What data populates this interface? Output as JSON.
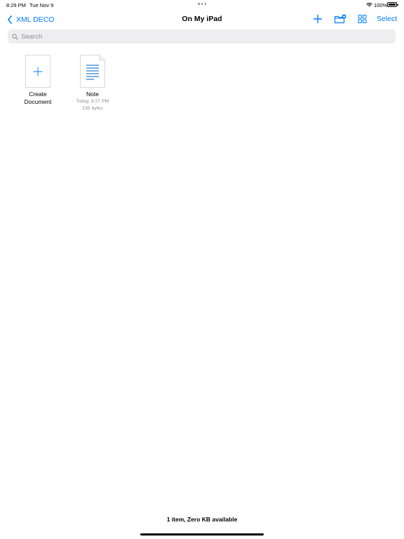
{
  "status_bar": {
    "time": "8:29 PM",
    "date": "Tue Nov 9",
    "battery": "100%",
    "icons": [
      "wifi-icon",
      "battery-icon"
    ]
  },
  "nav": {
    "back_label": "XML DECO",
    "title": "On My iPad",
    "select_label": "Select",
    "icons": [
      "chevron-left-icon",
      "plus-icon",
      "folder-badge-plus-icon",
      "grid-icon"
    ]
  },
  "search": {
    "placeholder": "Search",
    "value": ""
  },
  "items": [
    {
      "name_line1": "Create",
      "name_line2": "Document",
      "icon": "plus-icon"
    },
    {
      "name": "Note",
      "modified": "Today, 8:27 PM",
      "size": "135 bytes",
      "icon": "document-icon"
    }
  ],
  "footer": {
    "summary": "1 item, Zero KB available"
  },
  "colors": {
    "accent": "#007aff",
    "secondary_text": "#8e8e93",
    "search_bg": "#eeeef0",
    "doc_lines": "#2f7fd6"
  }
}
